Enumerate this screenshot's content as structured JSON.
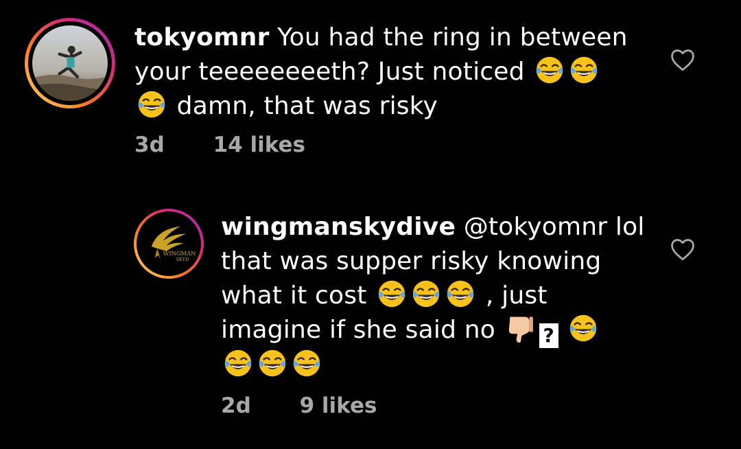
{
  "comments": [
    {
      "username": "tokyomnr",
      "text_parts": {
        "a": "You had the ring in between your teeeeeeeeth? Just noticed",
        "b": "damn, that was risky"
      },
      "age": "3d",
      "likes": "14 likes"
    },
    {
      "username": "wingmanskydive",
      "avatar_text": {
        "line1": "WINGMAN",
        "line2": "SKYD"
      },
      "text_parts": {
        "a": "@tokyomnr lol that was supper risky knowing what it cost",
        "b": ", just imagine if she said no",
        "missing_glyph": "?"
      },
      "age": "2d",
      "likes": "9 likes"
    }
  ],
  "colors": {
    "background": "#000000",
    "text": "#ffffff",
    "meta": "#a8a8a8",
    "story_ring_start": "#feda75",
    "story_ring_mid": "#d62976",
    "story_ring_end": "#962fbf",
    "emoji_face": "#f7c21b",
    "emoji_tears": "#5aa9e6",
    "thumb_skin": "#f5c9a4"
  },
  "icons": {
    "heart": "heart-outline-icon",
    "laugh": "face-with-tears-of-joy-emoji",
    "thumbs_down": "thumbs-down-emoji"
  }
}
